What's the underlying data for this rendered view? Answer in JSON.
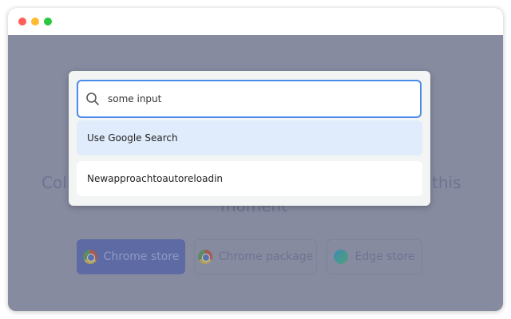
{
  "window": {
    "controls": {
      "close_color": "#ff5f57",
      "minimize_color": "#febc2e",
      "maximize_color": "#28c840"
    }
  },
  "background": {
    "text_left": "Coll",
    "text_right": "this",
    "text_line2": "moment",
    "buttons": [
      {
        "label": "Chrome store",
        "icon": "chrome-icon"
      },
      {
        "label": "Chrome package",
        "icon": "chrome-icon"
      },
      {
        "label": "Edge store",
        "icon": "edge-icon"
      }
    ]
  },
  "search": {
    "value": "some input",
    "icon": "search-icon"
  },
  "results": [
    {
      "label": "Use Google Search",
      "highlighted": true
    },
    {
      "label": "Newapproachtoautoreloadin",
      "highlighted": false
    }
  ]
}
